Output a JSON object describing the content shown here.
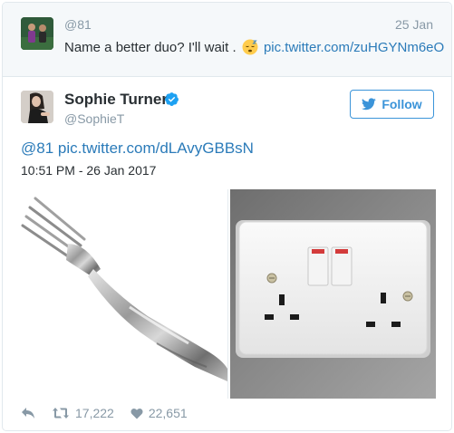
{
  "parent_tweet": {
    "handle": "@81",
    "date": "25 Jan",
    "text": "Name a better duo? I'll wait .",
    "emoji_icon": "sleepy-face-emoji",
    "link": "pic.twitter.com/zuHGYNm6eO"
  },
  "tweet": {
    "author_name": "Sophie Turner",
    "author_handle": "@SophieT",
    "verified": true,
    "follow_label": "Follow",
    "mention": "@81",
    "link": "pic.twitter.com/dLAvyGBBsN",
    "timestamp": "10:51 PM - 26 Jan 2017",
    "media": [
      {
        "subject": "fork"
      },
      {
        "subject": "double wall socket"
      }
    ],
    "actions": {
      "reply_icon": "reply-icon",
      "retweet_icon": "retweet-icon",
      "retweet_count": "17,222",
      "like_icon": "heart-icon",
      "like_count": "22,651"
    }
  },
  "colors": {
    "link": "#2b7bb9",
    "follow": "#3b94d9",
    "muted": "#8899a6",
    "text": "#292f33",
    "parent_bg": "#f5f8fa",
    "border": "#e1e8ed",
    "verified": "#1da1f2"
  }
}
